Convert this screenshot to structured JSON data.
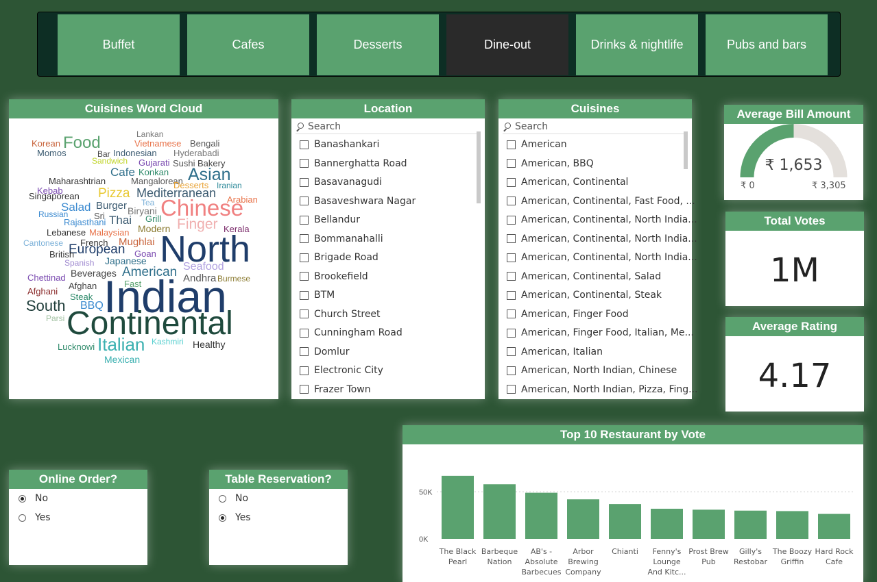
{
  "categories": [
    {
      "label": "Buffet",
      "active": false
    },
    {
      "label": "Cafes",
      "active": false
    },
    {
      "label": "Desserts",
      "active": false
    },
    {
      "label": "Dine-out",
      "active": true
    },
    {
      "label": "Drinks & nightlife",
      "active": false
    },
    {
      "label": "Pubs and bars",
      "active": false
    }
  ],
  "wordcloud": {
    "title": "Cuisines Word Cloud",
    "words": [
      {
        "t": "Korean",
        "c": "#c8643c",
        "s": 13
      },
      {
        "t": "Food",
        "c": "#5aa26f",
        "s": 24
      },
      {
        "t": "Lankan",
        "c": "#777",
        "s": 12
      },
      {
        "t": "Vietnamese",
        "c": "#e8734a",
        "s": 13
      },
      {
        "t": "Bengali",
        "c": "#555",
        "s": 13
      },
      {
        "t": "Momos",
        "c": "#3b5a70",
        "s": 13
      },
      {
        "t": "Bar",
        "c": "#444",
        "s": 12
      },
      {
        "t": "Indonesian",
        "c": "#3b5a70",
        "s": 13
      },
      {
        "t": "Hyderabadi",
        "c": "#777",
        "s": 13
      },
      {
        "t": "Sandwich",
        "c": "#c0d42a",
        "s": 12
      },
      {
        "t": "Gujarati",
        "c": "#7a4ab0",
        "s": 13
      },
      {
        "t": "Sushi",
        "c": "#555",
        "s": 13
      },
      {
        "t": "Bakery",
        "c": "#444",
        "s": 13
      },
      {
        "t": "Cafe",
        "c": "#2e6e8a",
        "s": 17
      },
      {
        "t": "Konkan",
        "c": "#2e8a6a",
        "s": 13
      },
      {
        "t": "Asian",
        "c": "#2e6e8a",
        "s": 25
      },
      {
        "t": "Maharashtrian",
        "c": "#333",
        "s": 13
      },
      {
        "t": "Mangalorean",
        "c": "#555",
        "s": 13
      },
      {
        "t": "Desserts",
        "c": "#e8a030",
        "s": 13
      },
      {
        "t": "Iranian",
        "c": "#2e8a9a",
        "s": 12
      },
      {
        "t": "Kebab",
        "c": "#7a4ab0",
        "s": 13
      },
      {
        "t": "Singaporean",
        "c": "#333",
        "s": 13
      },
      {
        "t": "Pizza",
        "c": "#e8c830",
        "s": 19
      },
      {
        "t": "Mediterranean",
        "c": "#3b5a70",
        "s": 18
      },
      {
        "t": "Arabian",
        "c": "#e8734a",
        "s": 13
      },
      {
        "t": "Tea",
        "c": "#7ab0d8",
        "s": 12
      },
      {
        "t": "Russian",
        "c": "#3b8ad0",
        "s": 12
      },
      {
        "t": "Salad",
        "c": "#3b8ad0",
        "s": 17
      },
      {
        "t": "Burger",
        "c": "#3b5a70",
        "s": 15
      },
      {
        "t": "Chinese",
        "c": "#f08080",
        "s": 33
      },
      {
        "t": "Sri",
        "c": "#555",
        "s": 13
      },
      {
        "t": "Biryani",
        "c": "#777",
        "s": 14
      },
      {
        "t": "Grill",
        "c": "#2e8a6a",
        "s": 13
      },
      {
        "t": "Rajasthani",
        "c": "#3b8ad0",
        "s": 13
      },
      {
        "t": "Thai",
        "c": "#3b5a70",
        "s": 17
      },
      {
        "t": "Finger",
        "c": "#f0b0b0",
        "s": 21
      },
      {
        "t": "Modern",
        "c": "#8a7a30",
        "s": 14
      },
      {
        "t": "Kerala",
        "c": "#7a2a6a",
        "s": 13
      },
      {
        "t": "Lebanese",
        "c": "#333",
        "s": 13
      },
      {
        "t": "Malaysian",
        "c": "#e8734a",
        "s": 13
      },
      {
        "t": "North",
        "c": "#1f3d6a",
        "s": 54
      },
      {
        "t": "Cantonese",
        "c": "#7ab0d8",
        "s": 12
      },
      {
        "t": "French",
        "c": "#333",
        "s": 13
      },
      {
        "t": "Mughlai",
        "c": "#c8643c",
        "s": 15
      },
      {
        "t": "European",
        "c": "#1f3d6a",
        "s": 19
      },
      {
        "t": "British",
        "c": "#333",
        "s": 13
      },
      {
        "t": "Goan",
        "c": "#7a4ab0",
        "s": 13
      },
      {
        "t": "Spanish",
        "c": "#a08ad0",
        "s": 12
      },
      {
        "t": "Japanese",
        "c": "#2e6e8a",
        "s": 14
      },
      {
        "t": "Seafood",
        "c": "#b0a0e0",
        "s": 16
      },
      {
        "t": "Beverages",
        "c": "#444",
        "s": 14
      },
      {
        "t": "American",
        "c": "#2e6e8a",
        "s": 19
      },
      {
        "t": "Chettinad",
        "c": "#7a4ab0",
        "s": 13
      },
      {
        "t": "Andhra",
        "c": "#555",
        "s": 15
      },
      {
        "t": "Burmese",
        "c": "#8a7a30",
        "s": 12
      },
      {
        "t": "Afghan",
        "c": "#444",
        "s": 13
      },
      {
        "t": "Fast",
        "c": "#5aa26f",
        "s": 13
      },
      {
        "t": "Afghani",
        "c": "#8a2a2a",
        "s": 13
      },
      {
        "t": "Indian",
        "c": "#1f3d6a",
        "s": 66
      },
      {
        "t": "Steak",
        "c": "#2e8a6a",
        "s": 13
      },
      {
        "t": "South",
        "c": "#1f3d3a",
        "s": 22
      },
      {
        "t": "BBQ",
        "c": "#3b8ad0",
        "s": 16
      },
      {
        "t": "Parsi",
        "c": "#a0c0a0",
        "s": 12
      },
      {
        "t": "Continental",
        "c": "#1f4a3d",
        "s": 48
      },
      {
        "t": "Lucknowi",
        "c": "#2e8a6a",
        "s": 13
      },
      {
        "t": "Italian",
        "c": "#3bb0b0",
        "s": 26
      },
      {
        "t": "Kashmiri",
        "c": "#5ad0d0",
        "s": 12
      },
      {
        "t": "Healthy",
        "c": "#333",
        "s": 14
      },
      {
        "t": "Mexican",
        "c": "#3bb0b0",
        "s": 14
      }
    ]
  },
  "location": {
    "title": "Location",
    "search_placeholder": "Search",
    "items": [
      "Banashankari",
      "Bannerghatta Road",
      "Basavanagudi",
      "Basaveshwara Nagar",
      "Bellandur",
      "Bommanahalli",
      "Brigade Road",
      "Brookefield",
      "BTM",
      "Church Street",
      "Cunningham Road",
      "Domlur",
      "Electronic City",
      "Frazer Town"
    ]
  },
  "cuisines": {
    "title": "Cuisines",
    "search_placeholder": "Search",
    "items": [
      "American",
      "American, BBQ",
      "American, Continental",
      "American, Continental, Fast Food, ...",
      "American, Continental, North India...",
      "American, Continental, North India...",
      "American, Continental, North India...",
      "American, Continental, Salad",
      "American, Continental, Steak",
      "American, Finger Food",
      "American, Finger Food, Italian, Me...",
      "American, Italian",
      "American, North Indian, Chinese",
      "American, North Indian, Pizza, Fing..."
    ]
  },
  "avg_bill": {
    "title": "Average Bill Amount",
    "value": "₹ 1,653",
    "min": "₹ 0",
    "max": "₹ 3,305",
    "fraction": 0.5
  },
  "total_votes": {
    "title": "Total Votes",
    "value": "1M"
  },
  "avg_rating": {
    "title": "Average Rating",
    "value": "4.17"
  },
  "online_order": {
    "title": "Online Order?",
    "options": [
      {
        "label": "No",
        "selected": true
      },
      {
        "label": "Yes",
        "selected": false
      }
    ]
  },
  "table_reservation": {
    "title": "Table Reservation?",
    "options": [
      {
        "label": "No",
        "selected": false
      },
      {
        "label": "Yes",
        "selected": true
      }
    ]
  },
  "chart_data": {
    "type": "bar",
    "title": "Top 10 Restaurant by Vote",
    "categories": [
      "The Black Pearl",
      "Barbeque Nation",
      "AB's - Absolute Barbecues",
      "Arbor Brewing Company",
      "Chianti",
      "Fenny's Lounge And Kitc...",
      "Prost Brew Pub",
      "Gilly's Restobar",
      "The Boozy Griffin",
      "Hard Rock Cafe"
    ],
    "values": [
      67000,
      58000,
      49000,
      42000,
      37000,
      32000,
      31000,
      30000,
      29500,
      26500
    ],
    "yticks": [
      {
        "v": 0,
        "label": "0K"
      },
      {
        "v": 50000,
        "label": "50K"
      }
    ],
    "ylim": [
      0,
      80000
    ],
    "color": "#5aa26f"
  }
}
